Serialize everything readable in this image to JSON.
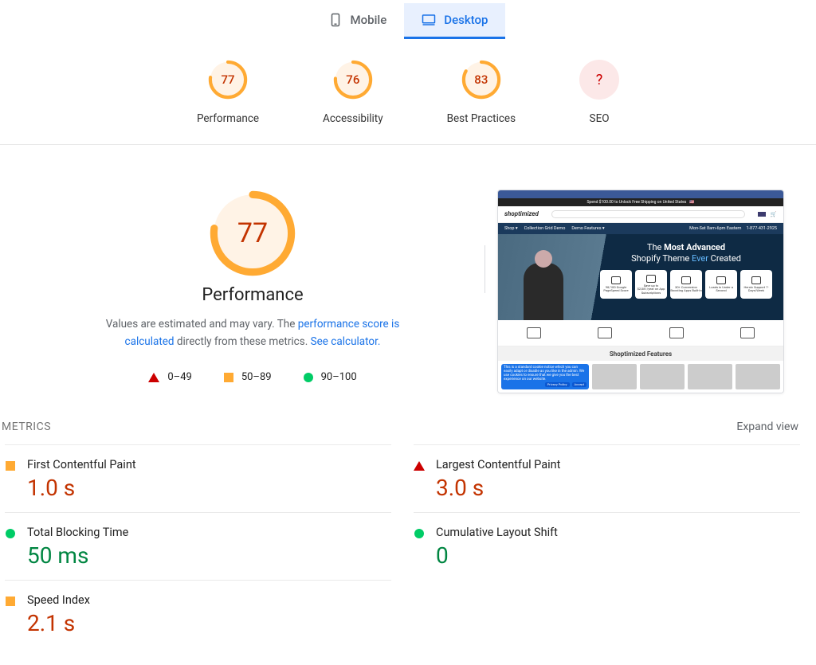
{
  "tabs": {
    "mobile_label": "Mobile",
    "desktop_label": "Desktop",
    "active": "desktop"
  },
  "gauges": {
    "performance": {
      "score": "77",
      "label": "Performance"
    },
    "accessibility": {
      "score": "76",
      "label": "Accessibility"
    },
    "best_practices": {
      "score": "83",
      "label": "Best Practices"
    },
    "seo": {
      "score": "?",
      "label": "SEO"
    }
  },
  "main": {
    "score": "77",
    "title": "Performance",
    "desc_prefix": "Values are estimated and may vary. The ",
    "desc_link1": "performance score is calculated",
    "desc_mid": " directly from these metrics. ",
    "desc_link2": "See calculator."
  },
  "legend": {
    "fail": "0–49",
    "avg": "50–89",
    "pass": "90–100"
  },
  "preview": {
    "logo": "shoptimized",
    "promo": "Spend $100.00 to Unlock Free Shipping on United States",
    "nav": {
      "items": [
        "Shop ▾",
        "Collection Grid Demo",
        "Demo Features ▾"
      ],
      "hours": "Mon-Sat 8am-6pm Eastern",
      "phone": "1-877-431-2925"
    },
    "hero_title_a": "The ",
    "hero_title_b": "Most Advanced",
    "hero_title_c": "Shopify Theme ",
    "hero_title_d": "Ever",
    "hero_title_e": " Created",
    "cards": [
      "98/100 Google PageSpeed Score",
      "Save up to $2,081/year on App Subscriptions",
      "30+ Conversion Boosting Apps Built-In",
      "Loads in Under a Second",
      "Heroic Support 7-Days/Week"
    ],
    "features_title": "Shoptimized Features",
    "notice": "This is a standard cookie notice which you can easily adapt or disable as you like in the admin. We use cookies to ensure that we give you the best experience on our website.",
    "notice_btn1": "Privacy Policy",
    "notice_btn2": "Accept"
  },
  "metrics": {
    "header": "METRICS",
    "expand": "Expand view",
    "items": [
      {
        "name": "First Contentful Paint",
        "value": "1.0 s",
        "status": "avg"
      },
      {
        "name": "Largest Contentful Paint",
        "value": "3.0 s",
        "status": "fail"
      },
      {
        "name": "Total Blocking Time",
        "value": "50 ms",
        "status": "pass"
      },
      {
        "name": "Cumulative Layout Shift",
        "value": "0",
        "status": "pass"
      },
      {
        "name": "Speed Index",
        "value": "2.1 s",
        "status": "avg"
      }
    ]
  },
  "chart_data": [
    {
      "type": "pie",
      "title": "Performance",
      "values": [
        77,
        23
      ],
      "categories": [
        "score",
        "remaining"
      ],
      "ylim": [
        0,
        100
      ]
    },
    {
      "type": "pie",
      "title": "Accessibility",
      "values": [
        76,
        24
      ],
      "categories": [
        "score",
        "remaining"
      ],
      "ylim": [
        0,
        100
      ]
    },
    {
      "type": "pie",
      "title": "Best Practices",
      "values": [
        83,
        17
      ],
      "categories": [
        "score",
        "remaining"
      ],
      "ylim": [
        0,
        100
      ]
    }
  ]
}
